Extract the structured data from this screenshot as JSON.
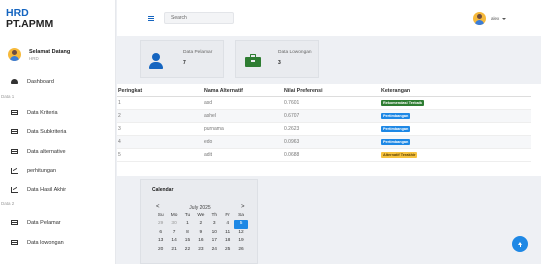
{
  "brand": {
    "line1": "HRD",
    "line2": "PT.APMM"
  },
  "user": {
    "greeting": "Selamat Datang",
    "role": "HRD"
  },
  "sidebar": {
    "dashboard": "Dashboard",
    "section1": "Data 1",
    "section2": "Data 2",
    "items1": [
      "Data Kriteria",
      "Data Subkriteria",
      "Data alternative",
      "perhitungan",
      "Data Hasil Akhir"
    ],
    "items2": [
      "Data Pelamar",
      "Data lowongan"
    ]
  },
  "topbar": {
    "search_placeholder": "Search",
    "username": "alex"
  },
  "cards": [
    {
      "label": "Data Pelamar",
      "value": "7"
    },
    {
      "label": "Data Lowongan",
      "value": "3"
    }
  ],
  "table": {
    "headers": [
      "Peringkat",
      "Nama Alternatif",
      "Nilai Preferensi",
      "Keterangan"
    ],
    "rows": [
      {
        "rank": "1",
        "name": "asd",
        "score": "0.7601",
        "status": "Rekomendasi Terbaik",
        "status_color": "#2e7d32"
      },
      {
        "rank": "2",
        "name": "ashel",
        "score": "0.6707",
        "status": "Pertimbangan",
        "status_color": "#1e88e5"
      },
      {
        "rank": "3",
        "name": "purnama",
        "score": "0.2623",
        "status": "Pertimbangan",
        "status_color": "#1e88e5"
      },
      {
        "rank": "4",
        "name": "edo",
        "score": "0.0963",
        "status": "Pertimbangan",
        "status_color": "#1e88e5"
      },
      {
        "rank": "5",
        "name": "adit",
        "score": "0.0688",
        "status": "Alternatif Terakhir",
        "status_color": "#f6c23e"
      }
    ]
  },
  "calendar": {
    "title": "Calendar",
    "month": "July 2025",
    "prev": "<",
    "next": ">",
    "days_of_week": [
      "Su",
      "Mo",
      "Tu",
      "We",
      "Th",
      "Fr",
      "Sa"
    ],
    "dates": [
      {
        "d": "29",
        "m": true
      },
      {
        "d": "30",
        "m": true
      },
      {
        "d": "1"
      },
      {
        "d": "2"
      },
      {
        "d": "3"
      },
      {
        "d": "4"
      },
      {
        "d": "5",
        "sel": true
      },
      {
        "d": "6"
      },
      {
        "d": "7"
      },
      {
        "d": "8"
      },
      {
        "d": "9"
      },
      {
        "d": "10"
      },
      {
        "d": "11"
      },
      {
        "d": "12"
      },
      {
        "d": "13"
      },
      {
        "d": "14"
      },
      {
        "d": "15"
      },
      {
        "d": "16"
      },
      {
        "d": "17"
      },
      {
        "d": "18"
      },
      {
        "d": "19"
      },
      {
        "d": "20"
      },
      {
        "d": "21"
      },
      {
        "d": "22"
      },
      {
        "d": "23"
      },
      {
        "d": "24"
      },
      {
        "d": "25"
      },
      {
        "d": "26"
      }
    ]
  },
  "colors": {
    "primary": "#1565c0",
    "accent": "#1e88e5",
    "success": "#2e7d32",
    "warning": "#f6c23e"
  }
}
